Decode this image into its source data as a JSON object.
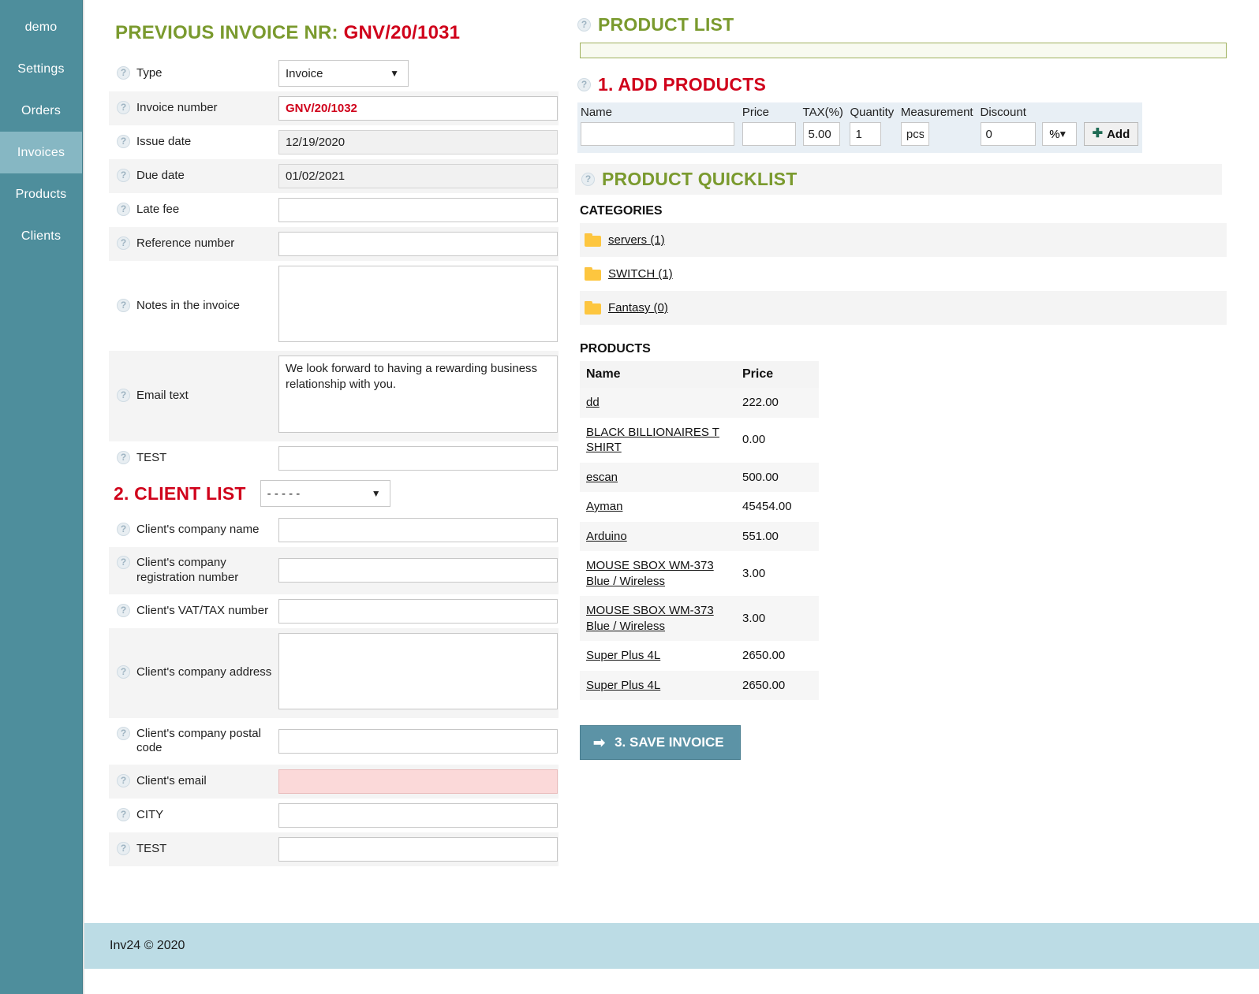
{
  "sidebar": {
    "items": [
      {
        "label": "demo",
        "active": false
      },
      {
        "label": "Settings",
        "active": false
      },
      {
        "label": "Orders",
        "active": false
      },
      {
        "label": "Invoices",
        "active": true
      },
      {
        "label": "Products",
        "active": false
      },
      {
        "label": "Clients",
        "active": false
      }
    ]
  },
  "invoice": {
    "title_prefix": "PREVIOUS INVOICE NR:",
    "previous_nr": "GNV/20/1031",
    "help_icon": "question-icon",
    "fields": [
      {
        "label": "Type",
        "kind": "select",
        "value": "Invoice",
        "placeholder": ""
      },
      {
        "label": "Invoice number",
        "kind": "text-red",
        "value": "GNV/20/1032",
        "placeholder": ""
      },
      {
        "label": "Issue date",
        "kind": "readonly",
        "value": "12/19/2020",
        "placeholder": ""
      },
      {
        "label": "Due date",
        "kind": "readonly",
        "value": "01/02/2021",
        "placeholder": ""
      },
      {
        "label": "Late fee",
        "kind": "text",
        "value": "",
        "placeholder": ""
      },
      {
        "label": "Reference number",
        "kind": "text",
        "value": "",
        "placeholder": ""
      },
      {
        "label": "Notes in the invoice",
        "kind": "textarea",
        "value": "",
        "placeholder": ""
      },
      {
        "label": "Email text",
        "kind": "textarea",
        "value": "We look forward to having a rewarding business relationship with you.",
        "placeholder": ""
      },
      {
        "label": "TEST",
        "kind": "text",
        "value": "",
        "placeholder": ""
      }
    ]
  },
  "client": {
    "heading": "2. CLIENT LIST",
    "select_value": "- - - - -",
    "fields": [
      {
        "label": "Client's company name",
        "kind": "text",
        "value": "",
        "placeholder": ""
      },
      {
        "label": "Client's company registration number",
        "kind": "text",
        "value": "",
        "placeholder": ""
      },
      {
        "label": "Client's VAT/TAX number",
        "kind": "text",
        "value": "",
        "placeholder": ""
      },
      {
        "label": "Client's company address",
        "kind": "textarea",
        "value": "",
        "placeholder": ""
      },
      {
        "label": "Client's company postal code",
        "kind": "text",
        "value": "",
        "placeholder": ""
      },
      {
        "label": "Client's email",
        "kind": "error",
        "value": "",
        "placeholder": ""
      },
      {
        "label": "CITY",
        "kind": "text",
        "value": "",
        "placeholder": ""
      },
      {
        "label": "TEST",
        "kind": "text",
        "value": "",
        "placeholder": ""
      }
    ]
  },
  "product_list": {
    "heading": "PRODUCT LIST",
    "search_value": "",
    "search_placeholder": ""
  },
  "add_products": {
    "heading": "1. ADD PRODUCTS",
    "columns": [
      "Name",
      "Price",
      "TAX(%)",
      "Quantity",
      "Measurement",
      "Discount"
    ],
    "name_value": "",
    "price_value": "",
    "tax_value": "5.00",
    "quantity_value": "1",
    "measurement_value": "pcs",
    "discount_value": "0",
    "discount_unit": "%",
    "add_label": "Add",
    "add_icon": "plus-icon"
  },
  "quicklist": {
    "heading": "PRODUCT QUICKLIST",
    "categories_label": "CATEGORIES",
    "categories": [
      {
        "name": "servers (1)",
        "icon": "folder-icon"
      },
      {
        "name": "SWITCH (1)",
        "icon": "folder-icon"
      },
      {
        "name": "Fantasy (0)",
        "icon": "folder-icon"
      }
    ],
    "products_label": "PRODUCTS",
    "product_columns": [
      "Name",
      "Price"
    ],
    "products": [
      {
        "name": "dd",
        "price": "222.00"
      },
      {
        "name": "BLACK BILLIONAIRES T SHIRT",
        "price": "0.00"
      },
      {
        "name": "escan",
        "price": "500.00"
      },
      {
        "name": "Ayman",
        "price": "45454.00"
      },
      {
        "name": "Arduino",
        "price": "551.00"
      },
      {
        "name": "MOUSE SBOX WM-373 Blue / Wireless",
        "price": "3.00"
      },
      {
        "name": "MOUSE SBOX WM-373 Blue / Wireless",
        "price": "3.00"
      },
      {
        "name": "Super Plus 4L",
        "price": "2650.00"
      },
      {
        "name": "Super Plus 4L",
        "price": "2650.00"
      }
    ]
  },
  "save": {
    "label": "3. SAVE INVOICE",
    "icon": "arrow-right-icon"
  },
  "footer": {
    "text": "Inv24 © 2020"
  },
  "colors": {
    "sidebar": "#4e8e9c",
    "sidebar_active": "#86b7c3",
    "green": "#7a9a2e",
    "red": "#d0021b",
    "save_button": "#5c93a6",
    "footer": "#bcdce5",
    "error_field": "#fbd9d9"
  }
}
